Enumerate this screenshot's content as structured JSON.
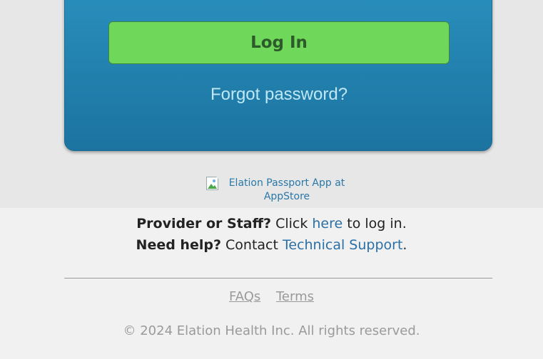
{
  "login_card": {
    "login_button_label": "Log In",
    "forgot_password_label": "Forgot password?"
  },
  "appstore": {
    "alt_text": "Elation Passport App at AppStore"
  },
  "footer": {
    "provider_prompt": "Provider or Staff?",
    "provider_click": "Click",
    "provider_link": "here",
    "provider_suffix": "to log in.",
    "help_prompt": "Need help?",
    "help_contact": "Contact",
    "help_link": "Technical Support",
    "help_suffix": ".",
    "links": [
      "FAQs",
      "Terms"
    ],
    "copyright": "© 2024 Elation Health Inc. All rights reserved."
  },
  "colors": {
    "card_blue": "#2484b1",
    "login_green": "#6fd85a",
    "link_blue": "#2a6fa6",
    "muted_gray": "#9a9a9a"
  }
}
